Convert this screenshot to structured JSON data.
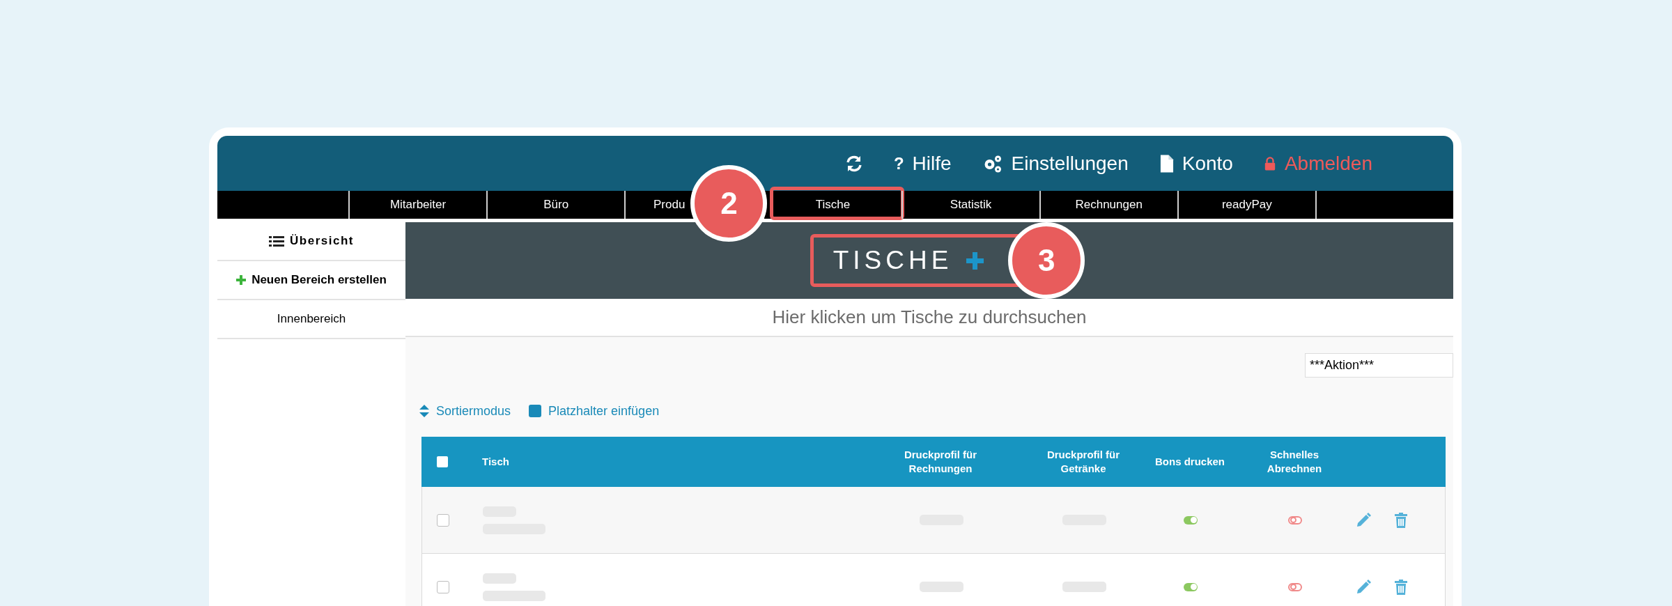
{
  "topbar": {
    "items": [
      {
        "kind": "refresh"
      },
      {
        "kind": "help",
        "glyph": "?",
        "label": "Hilfe"
      },
      {
        "kind": "settings",
        "label": "Einstellungen"
      },
      {
        "kind": "account",
        "label": "Konto"
      },
      {
        "kind": "logout",
        "label": "Abmelden"
      }
    ]
  },
  "nav": {
    "tabs": [
      {
        "label": "Mitarbeiter",
        "highlighted": false
      },
      {
        "label": "Büro",
        "highlighted": false
      },
      {
        "label": "Produ",
        "highlighted": false
      },
      {
        "label": "Tische",
        "highlighted": true,
        "callout": "2"
      },
      {
        "label": "Statistik",
        "highlighted": false
      },
      {
        "label": "Rechnungen",
        "highlighted": false
      },
      {
        "label": "readyPay",
        "highlighted": false
      }
    ]
  },
  "sidebar": {
    "items": [
      {
        "kind": "overview",
        "label": "Übersicht"
      },
      {
        "kind": "create",
        "label": "Neuen Bereich erstellen"
      },
      {
        "kind": "area",
        "label": "Innenbereich"
      }
    ]
  },
  "title": {
    "text": "TISCHE",
    "highlighted": true,
    "callout": "3"
  },
  "search": {
    "placeholder": "Hier klicken um Tische zu durchsuchen"
  },
  "action_select": {
    "value": "***Aktion***"
  },
  "tools": [
    {
      "kind": "sort",
      "label": "Sortiermodus"
    },
    {
      "kind": "placeholder",
      "label": "Platzhalter einfügen"
    }
  ],
  "table": {
    "select_all": {
      "checked": false
    },
    "columns": [
      "Tisch",
      "Druckprofil für Rechnungen",
      "Druckprofil für Getränke",
      "Bons drucken",
      "Schnelles Abrechnen"
    ],
    "rows": [
      {
        "checked": false,
        "bons_drucken": true,
        "schnelles_abrechnen": false
      },
      {
        "checked": false,
        "bons_drucken": true,
        "schnelles_abrechnen": false
      }
    ]
  }
}
